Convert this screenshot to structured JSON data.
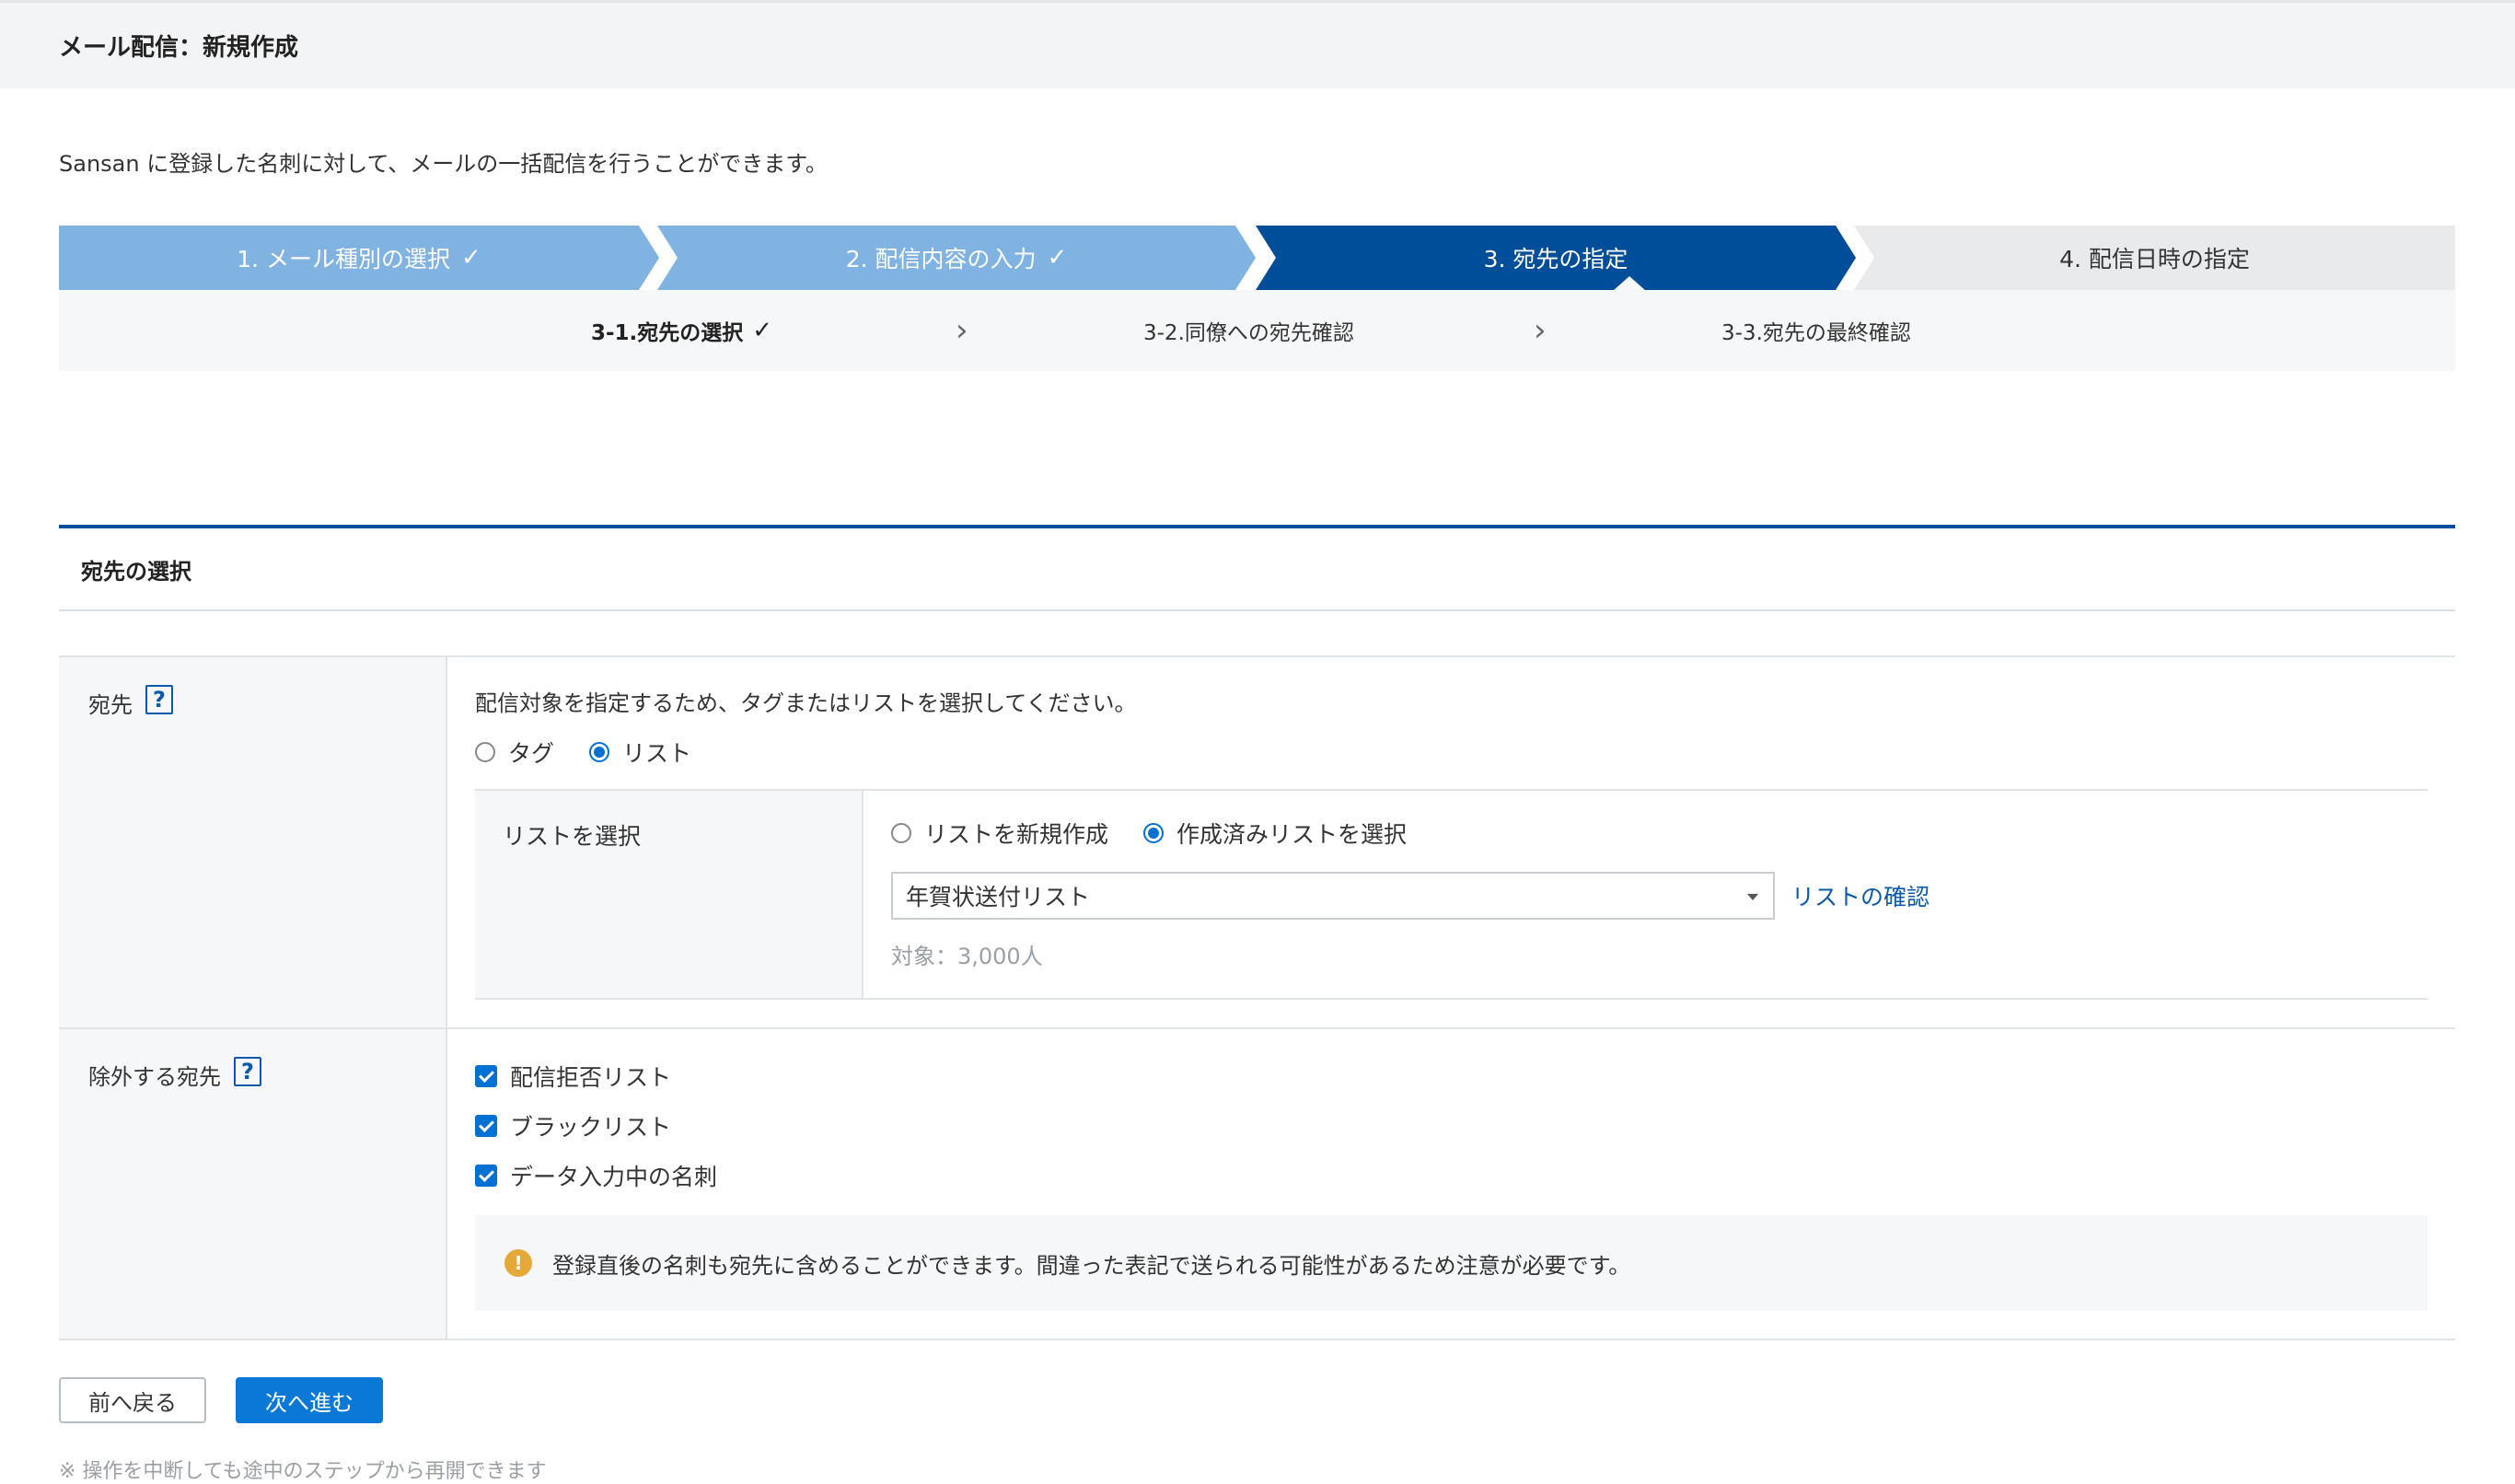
{
  "header": {
    "title": "メール配信：新規作成"
  },
  "intro": "Sansan に登録した名刺に対して、メールの一括配信を行うことができます。",
  "steps": [
    {
      "label": "1.  メール種別の選択",
      "check": "✓"
    },
    {
      "label": "2.  配信内容の入力",
      "check": "✓"
    },
    {
      "label": "3.  宛先の指定",
      "check": ""
    },
    {
      "label": "4.  配信日時の指定",
      "check": ""
    }
  ],
  "substeps": [
    {
      "label": "3-1.宛先の選択",
      "check": "✓"
    },
    {
      "label": "3-2.同僚への宛先確認"
    },
    {
      "label": "3-3.宛先の最終確認"
    }
  ],
  "section": {
    "title": "宛先の選択"
  },
  "recipient": {
    "label": "宛先",
    "help": "?",
    "description": "配信対象を指定するため、タグまたはリストを選択してください。",
    "options": [
      "タグ",
      "リスト"
    ],
    "selected": "リスト",
    "list_select": {
      "label": "リストを選択",
      "options": [
        "リストを新規作成",
        "作成済みリストを選択"
      ],
      "selected": "作成済みリストを選択",
      "dropdown_value": "年賀状送付リスト",
      "confirm_link": "リストの確認",
      "count_text": "対象：3,000人"
    }
  },
  "exclude": {
    "label": "除外する宛先",
    "help": "?",
    "items": [
      "配信拒否リスト",
      "ブラックリスト",
      "データ入力中の名刺"
    ],
    "notice_icon": "!",
    "notice": "登録直後の名刺も宛先に含めることができます。間違った表記で送られる可能性があるため注意が必要です。"
  },
  "buttons": {
    "back": "前へ戻る",
    "next": "次へ進む"
  },
  "footnote": "※ 操作を中断しても途中のステップから再開できます",
  "colors": {
    "primary": "#004d99",
    "completed": "#80b3e1",
    "accent": "#0070d2",
    "warning": "#e5a93a"
  }
}
